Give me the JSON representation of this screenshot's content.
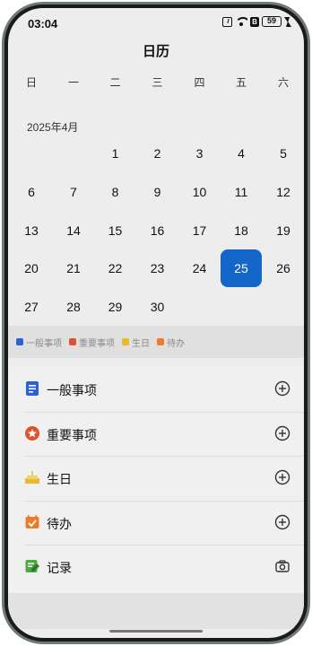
{
  "status": {
    "time": "03:04",
    "b_label": "B",
    "battery": "59"
  },
  "app": {
    "title": "日历"
  },
  "weekdays": [
    "日",
    "一",
    "二",
    "三",
    "四",
    "五",
    "六"
  ],
  "month_label": "2025年4月",
  "calendar": {
    "selected": "25",
    "rows": [
      [
        "",
        "",
        "1",
        "2",
        "3",
        "4",
        "5"
      ],
      [
        "6",
        "7",
        "8",
        "9",
        "10",
        "11",
        "12"
      ],
      [
        "13",
        "14",
        "15",
        "16",
        "17",
        "18",
        "19"
      ],
      [
        "20",
        "21",
        "22",
        "23",
        "24",
        "25",
        "26"
      ],
      [
        "27",
        "28",
        "29",
        "30",
        "",
        "",
        ""
      ]
    ]
  },
  "legend": [
    {
      "label": "一般事项",
      "color": "#2d5fd6",
      "icon": "list-icon"
    },
    {
      "label": "重要事项",
      "color": "#e0522d",
      "icon": "star-icon"
    },
    {
      "label": "生日",
      "color": "#e8b92b",
      "icon": "cake-icon"
    },
    {
      "label": "待办",
      "color": "#ef7a2a",
      "icon": "todo-icon"
    }
  ],
  "actions": [
    {
      "label": "一般事项",
      "icon": "list-icon",
      "action_icon": "add-icon",
      "color": "#2d5fd6"
    },
    {
      "label": "重要事项",
      "icon": "star-icon",
      "action_icon": "add-icon",
      "color": "#e0522d"
    },
    {
      "label": "生日",
      "icon": "cake-icon",
      "action_icon": "add-icon",
      "color": "#e8b92b"
    },
    {
      "label": "待办",
      "icon": "todo-icon",
      "action_icon": "add-icon",
      "color": "#ef7a2a"
    },
    {
      "label": "记录",
      "icon": "note-icon",
      "action_icon": "camera-icon",
      "color": "#4fa843"
    }
  ]
}
